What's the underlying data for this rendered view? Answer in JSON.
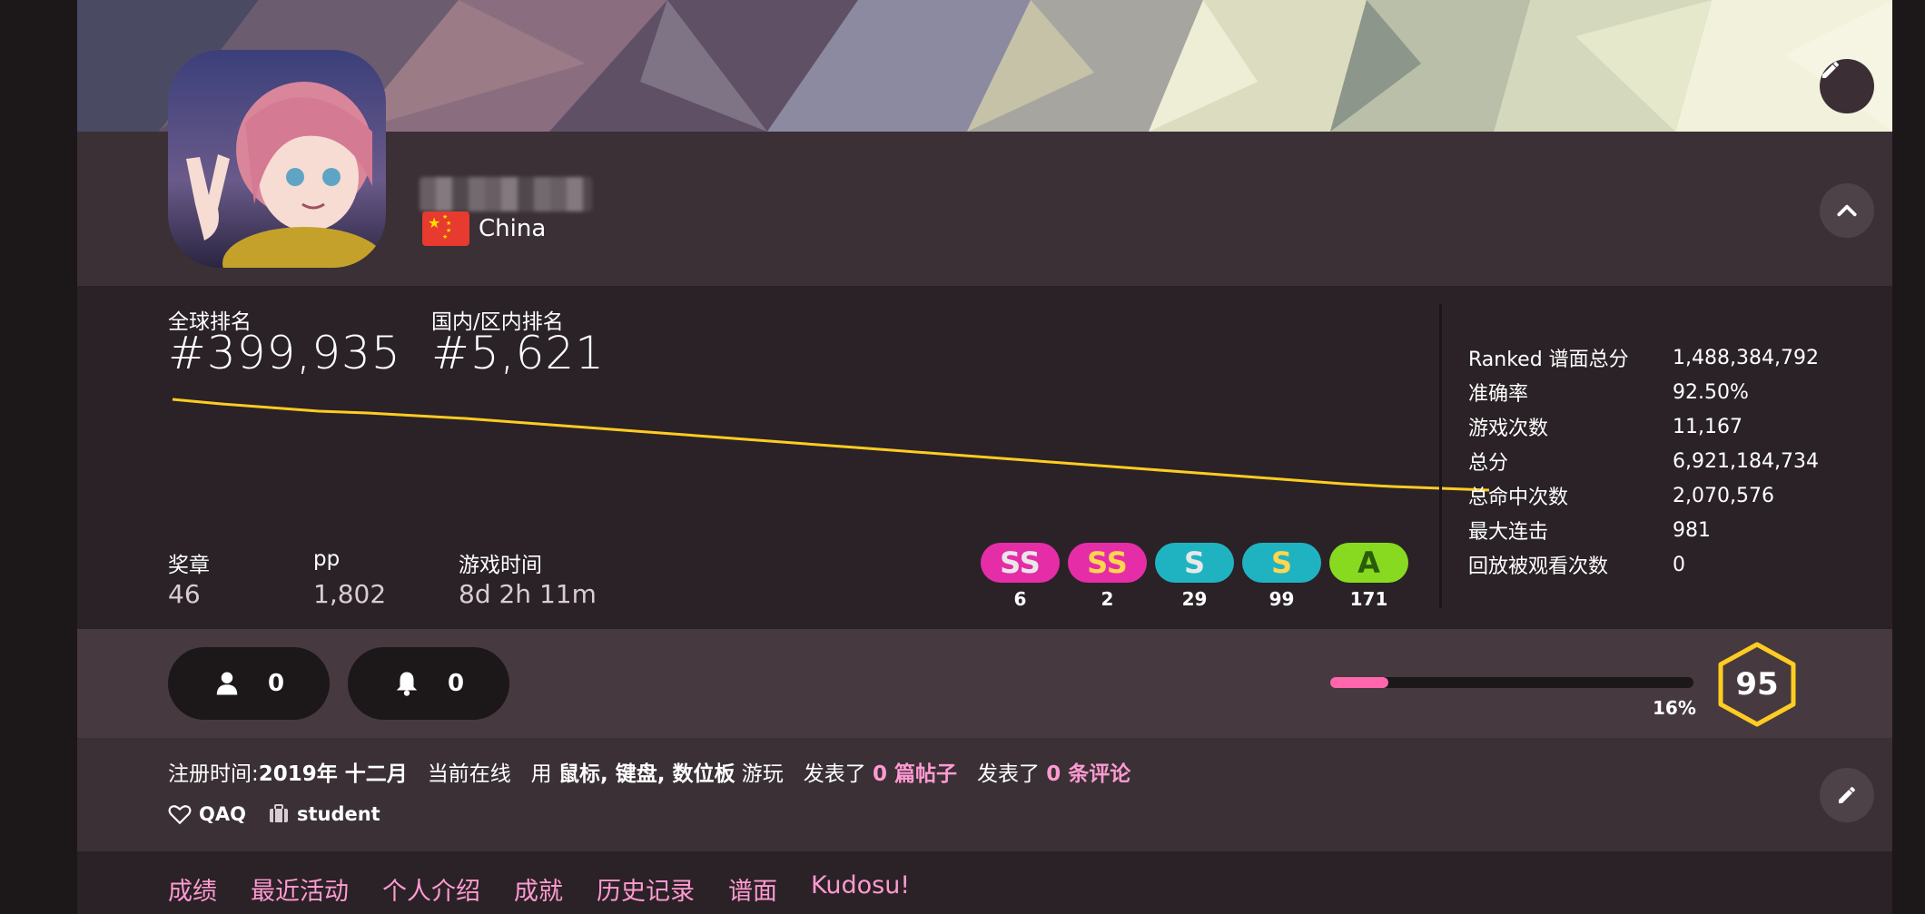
{
  "profile": {
    "country": "China",
    "country_flag_icon": "china-flag-icon",
    "username": ""
  },
  "ranks": {
    "global_label": "全球排名",
    "global_value": "#399,935",
    "country_label": "国内/区内排名",
    "country_value": "#5,621"
  },
  "chart_data": {
    "type": "line",
    "series": [
      {
        "values": [
          100,
          95,
          91,
          87,
          85,
          82,
          79,
          75,
          71,
          67,
          63,
          59,
          55,
          51,
          47,
          43,
          39,
          35,
          31,
          27,
          23,
          19,
          15,
          11,
          7,
          4,
          2,
          0
        ]
      }
    ],
    "line_color": "#ffcc22"
  },
  "minor_stats": [
    {
      "label": "奖章",
      "value": "46"
    },
    {
      "label": "pp",
      "value": "1,802"
    },
    {
      "label": "游戏时间",
      "value": "8d 2h 11m"
    }
  ],
  "grades": [
    {
      "grade": "SS",
      "count": "6",
      "bg": "#e52da8",
      "fg": "#e8e8e8",
      "name": "grade-ssh-badge"
    },
    {
      "grade": "SS",
      "count": "2",
      "bg": "#e52da8",
      "fg": "#ffd64d",
      "name": "grade-ss-badge"
    },
    {
      "grade": "S",
      "count": "29",
      "bg": "#1fb3c2",
      "fg": "#e8e8e8",
      "name": "grade-sh-badge"
    },
    {
      "grade": "S",
      "count": "99",
      "bg": "#1fb3c2",
      "fg": "#ffd64d",
      "name": "grade-s-badge"
    },
    {
      "grade": "A",
      "count": "171",
      "bg": "#88da20",
      "fg": "#2a5c0a",
      "name": "grade-a-badge"
    }
  ],
  "details": [
    {
      "key": "Ranked 谱面总分",
      "value": "1,488,384,792"
    },
    {
      "key": "准确率",
      "value": "92.50%"
    },
    {
      "key": "游戏次数",
      "value": "11,167"
    },
    {
      "key": "总分",
      "value": "6,921,184,734"
    },
    {
      "key": "总命中次数",
      "value": "2,070,576"
    },
    {
      "key": "最大连击",
      "value": "981"
    },
    {
      "key": "回放被观看次数",
      "value": "0"
    }
  ],
  "social": {
    "followers": "0",
    "mapping_followers": "0"
  },
  "level": {
    "progress_percent": 16,
    "progress_text": "16%",
    "value": "95",
    "ring_color": "#ffcc22"
  },
  "info": {
    "joined_label": "注册时间:",
    "joined_value": "2019年 十二月",
    "online": "当前在线",
    "plays_with_prefix": "用",
    "plays_with_value": "鼠标, 键盘, 数位板",
    "plays_with_suffix": "游玩",
    "posts_prefix": "发表了",
    "posts_value": "0 篇帖子",
    "comments_prefix": "发表了",
    "comments_value": "0 条评论",
    "interests": "QAQ",
    "occupation": "student"
  },
  "tabs": [
    "成绩",
    "最近活动",
    "个人介绍",
    "成就",
    "历史记录",
    "谱面",
    "Kudosu!"
  ]
}
